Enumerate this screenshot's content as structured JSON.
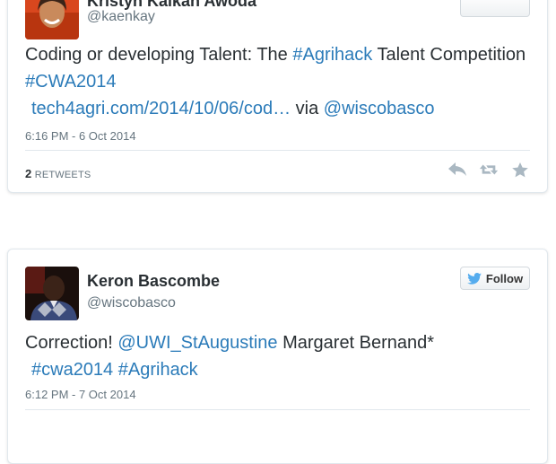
{
  "tweets": [
    {
      "display_name": "Kristyn Kalkah Awoda",
      "handle": "@kaenkay",
      "text_parts": {
        "t1": "Coding or developing Talent: The ",
        "hashtag1": "#Agrihack",
        "t2": " Talent Competition ",
        "hashtag2": "#CWA2014",
        "link": "tech4agri.com/2014/10/06/cod…",
        "t3": " via ",
        "mention": "@wiscobasco"
      },
      "timestamp": "6:16 PM - 6 Oct 2014",
      "retweet_count": "2",
      "retweet_label": "RETWEETS",
      "actions": [
        "reply-icon",
        "retweet-icon",
        "favorite-icon"
      ]
    },
    {
      "display_name": "Keron Bascombe",
      "handle": "@wiscobasco",
      "follow_label": "Follow",
      "text_parts": {
        "t1": "Correction! ",
        "mention": "@UWI_StAugustine",
        "t2": " Margaret Bernand* ",
        "hashtag1": "#cwa2014",
        "t3": " ",
        "hashtag2": "#Agrihack"
      },
      "timestamp": "6:12 PM - 7 Oct 2014"
    }
  ],
  "colors": {
    "link": "#2b7bb9",
    "text": "#292f33",
    "muted": "#66757f",
    "twitter_bird": "#55acee"
  }
}
